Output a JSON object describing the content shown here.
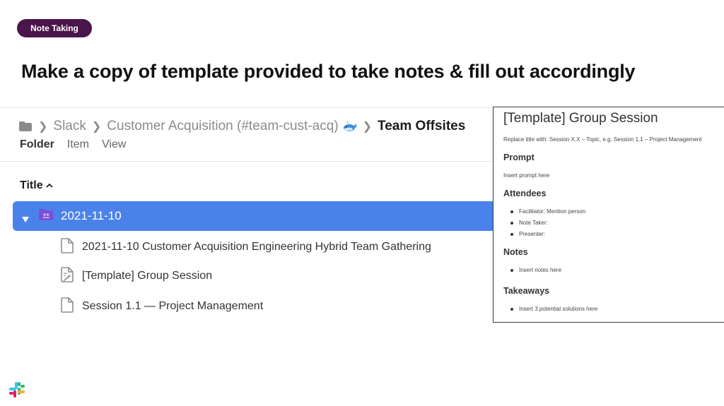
{
  "badge": "Note Taking",
  "headline": "Make a copy of template provided to take notes & fill out accordingly",
  "breadcrumb": {
    "items": [
      "Slack",
      "Customer Acquisition (#team-cust-acq)"
    ],
    "current": "Team Offsites"
  },
  "menu": [
    "Folder",
    "Item",
    "View"
  ],
  "list": {
    "column_title": "Title",
    "selected_folder": "2021-11-10",
    "documents": [
      "2021-11-10 Customer Acquisition Engineering Hybrid Team Gathering",
      "[Template] Group Session",
      "Session 1.1 — Project Management"
    ]
  },
  "template_doc": {
    "title": "[Template] Group Session",
    "instruction": "Replace title with: Session X.X – Topic, e.g. Session 1.1 – Project Management",
    "prompt_heading": "Prompt",
    "prompt_text": "Insert prompt here",
    "attendees_heading": "Attendees",
    "attendees": [
      "Facilitator: Mention person",
      "Note Taker:",
      "Presenter:"
    ],
    "notes_heading": "Notes",
    "notes": [
      "Insert notes here"
    ],
    "takeaways_heading": "Takeaways",
    "takeaways": [
      "Insert 3 potential solutions here"
    ]
  },
  "colors": {
    "badge_bg": "#4a154b",
    "selection_bg": "#4b82ea",
    "folder_icon_purple": "#7a4fd9"
  },
  "icons": [
    "folder-icon",
    "chevron-right-icon",
    "whale-emoji-icon",
    "sort-up-icon",
    "disclosure-triangle-icon",
    "shared-folder-icon",
    "document-icon",
    "template-document-icon",
    "slack-logo-icon"
  ]
}
